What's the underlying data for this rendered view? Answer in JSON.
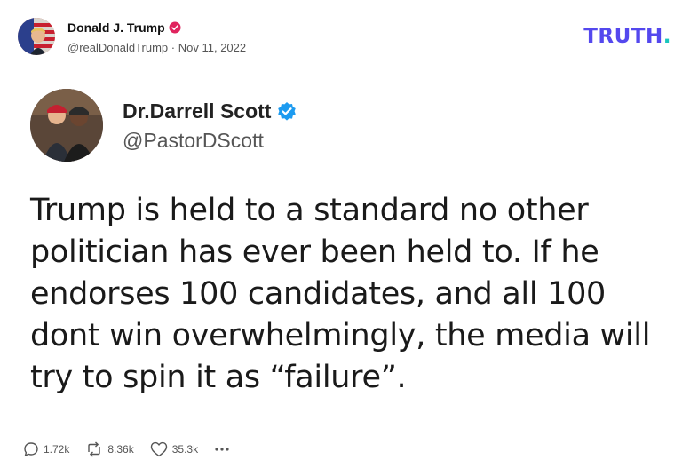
{
  "post": {
    "author_name": "Donald J. Trump",
    "handle": "@realDonaldTrump",
    "separator": "·",
    "date": "Nov 11, 2022"
  },
  "brand": {
    "logo_text": "TRUTH",
    "logo_dot": ".",
    "color": "#5448ee",
    "dot_color": "#19c6bd"
  },
  "embedded_tweet": {
    "name": "Dr.Darrell Scott",
    "handle": "@PastorDScott",
    "verified_color": "#1d9bf0",
    "text_lines": [
      "Trump is held to a standard no other",
      "politician has ever been held to. If he",
      "endorses 100 candidates, and all 100",
      "dont win overwhelmingly, the media will",
      "try to spin it as “failure”."
    ]
  },
  "actions": {
    "replies": "1.72k",
    "retruths": "8.36k",
    "likes": "35.3k",
    "more_icon": "more-icon"
  },
  "colors": {
    "verified_badge_small": "#e0245e",
    "text_muted": "#555555"
  }
}
